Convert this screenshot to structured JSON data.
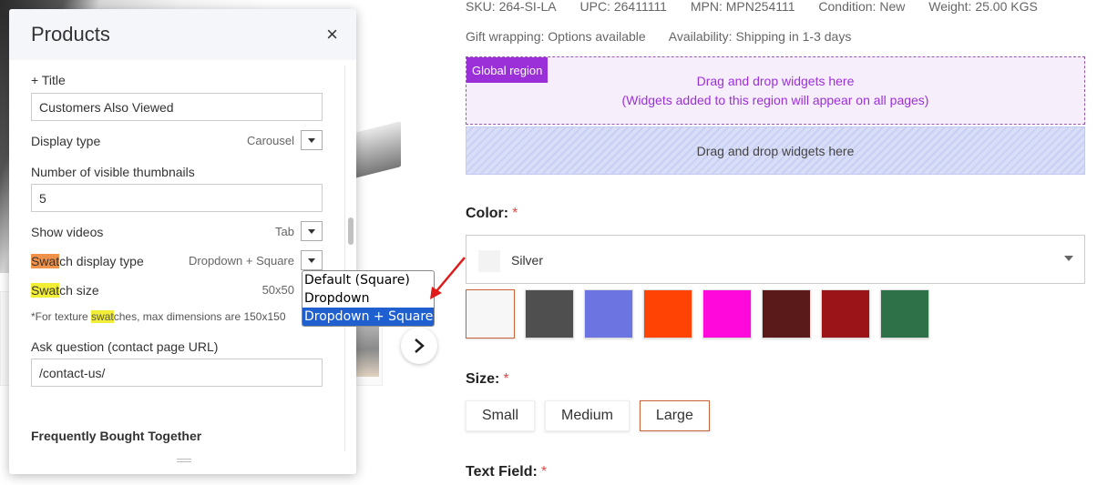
{
  "colors": {
    "accent_purple": "#9b30d9",
    "highlight_orange": "#f0924a",
    "highlight_yellow": "#f2ee36",
    "selection_blue": "#1f5fd0",
    "annotation_arrow": "#e01b1b"
  },
  "product": {
    "sku": "SKU: 264-SI-LA",
    "upc": "UPC: 26411111",
    "mpn": "MPN: MPN254111",
    "condition": "Condition: New",
    "weight": "Weight: 25.00 KGS",
    "gift": "Gift wrapping: Options available",
    "availability": "Availability: Shipping in 1-3 days",
    "global_region": {
      "badge": "Global region",
      "line1": "Drag and drop widgets here",
      "line2": "(Widgets added to this region will appear on all pages)"
    },
    "drop_region": "Drag and drop widgets here",
    "color": {
      "label": "Color:",
      "required_mark": "*",
      "selected": "Silver",
      "swatches": [
        {
          "name": "Silver",
          "hex": "#f7f7f7",
          "selected": true
        },
        {
          "name": "Dark gray",
          "hex": "#4f4f4f"
        },
        {
          "name": "Periwinkle",
          "hex": "#6b74e0"
        },
        {
          "name": "Orange",
          "hex": "#ff4304"
        },
        {
          "name": "Magenta",
          "hex": "#ff08dc"
        },
        {
          "name": "Maroon",
          "hex": "#5b1a1a"
        },
        {
          "name": "Red",
          "hex": "#9b1518"
        },
        {
          "name": "Green",
          "hex": "#2e7148"
        }
      ]
    },
    "size": {
      "label": "Size:",
      "required_mark": "*",
      "options": [
        {
          "label": "Small"
        },
        {
          "label": "Medium"
        },
        {
          "label": "Large",
          "selected": true
        }
      ]
    },
    "text_field": {
      "label": "Text Field:",
      "required_mark": "*"
    }
  },
  "panel": {
    "title": "Products",
    "close_glyph": "×",
    "title_label": "+ Title",
    "title_value": "Customers Also Viewed",
    "display_type": {
      "label": "Display type",
      "value": "Carousel"
    },
    "visible_thumbs": {
      "label": "Number of visible thumbnails",
      "value": "5"
    },
    "show_videos": {
      "label": "Show videos",
      "value": "Tab"
    },
    "swatch_display": {
      "label_hl": "Swat",
      "label_rest": "ch display type",
      "value": "Dropdown + Square"
    },
    "swatch_size": {
      "label_hl": "Swat",
      "label_rest": "ch size",
      "value": "50x50"
    },
    "note": {
      "pre": "*For texture ",
      "hl": "swat",
      "post": "ches, max dimensions are 150x150"
    },
    "ask_question": {
      "label": "Ask question (contact page URL)",
      "value": "/contact-us/"
    },
    "section_fbt": "Frequently Bought Together"
  },
  "dropdown_popup": {
    "options": [
      "Default (Square)",
      "Dropdown",
      "Dropdown + Square"
    ],
    "selected_index": 2
  }
}
